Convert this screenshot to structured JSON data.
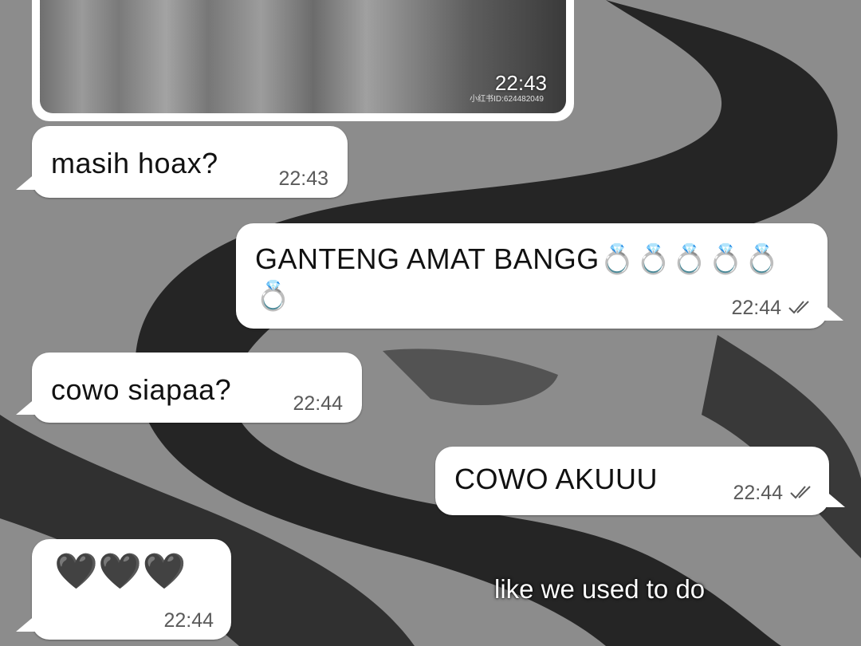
{
  "media_message": {
    "time": "22:43",
    "watermark": "小红书ID:624482049"
  },
  "messages": [
    {
      "direction": "incoming",
      "text": "masih hoax?",
      "time": "22:43"
    },
    {
      "direction": "outgoing",
      "text_line1": "GANTENG AMAT BANGG💍💍💍💍💍",
      "text_line2": "💍",
      "time": "22:44",
      "status": "read"
    },
    {
      "direction": "incoming",
      "text": "cowo siapaa?",
      "time": "22:44"
    },
    {
      "direction": "outgoing",
      "text": "COWO AKUUU",
      "time": "22:44",
      "status": "read"
    },
    {
      "direction": "incoming",
      "text": "🖤🖤🖤",
      "time": "22:44"
    }
  ],
  "overlay_caption": "like we used to do",
  "colors": {
    "bubble": "#ffffff",
    "background": "#8a8a8a",
    "time_text": "#5a5a5a"
  },
  "icons": {
    "read_receipt": "double-check-icon"
  }
}
